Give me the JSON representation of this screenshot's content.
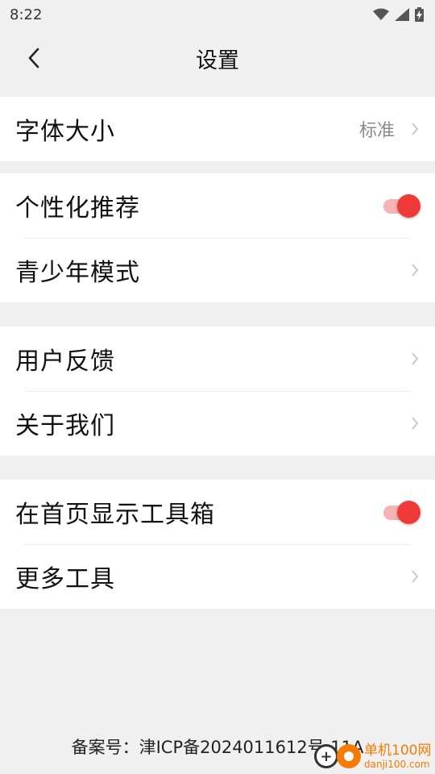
{
  "status_bar": {
    "time": "8:22"
  },
  "header": {
    "title": "设置"
  },
  "groups": [
    {
      "rows": [
        {
          "label": "字体大小",
          "value": "标准"
        }
      ]
    },
    {
      "rows": [
        {
          "label": "个性化推荐",
          "toggle": true
        },
        {
          "label": "青少年模式"
        }
      ]
    },
    {
      "rows": [
        {
          "label": "用户反馈"
        },
        {
          "label": "关于我们"
        }
      ]
    },
    {
      "rows": [
        {
          "label": "在首页显示工具箱",
          "toggle": true
        },
        {
          "label": "更多工具"
        }
      ]
    }
  ],
  "footer": {
    "icp": "备案号：津ICP备2024011612号-11A"
  },
  "watermark": {
    "name": "单机100网",
    "url": "danji100.com"
  },
  "colors": {
    "accent": "#f03a3a",
    "background": "#f0f0f0"
  }
}
